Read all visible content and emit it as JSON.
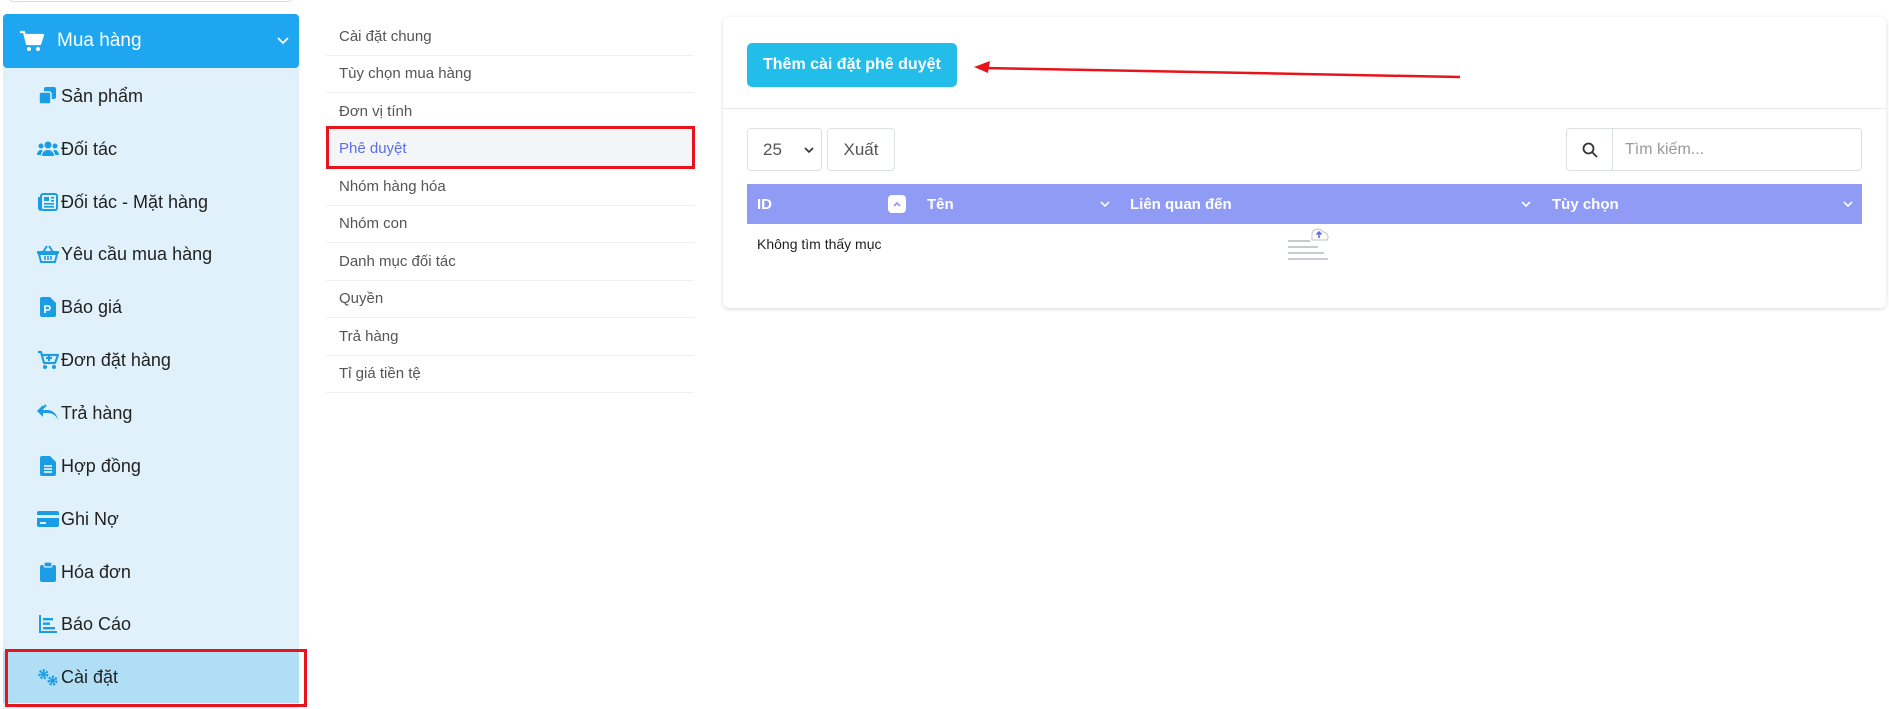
{
  "sidebar": {
    "header": {
      "label": "Mua hàng",
      "icon": "cart-icon"
    },
    "items": [
      {
        "label": "Sản phẩm",
        "icon": "products-icon"
      },
      {
        "label": "Đối tác",
        "icon": "users-icon"
      },
      {
        "label": "Đối tác - Mặt hàng",
        "icon": "newspaper-icon"
      },
      {
        "label": "Yêu cầu mua hàng",
        "icon": "basket-icon"
      },
      {
        "label": "Báo giá",
        "icon": "quote-file-icon"
      },
      {
        "label": "Đơn đặt hàng",
        "icon": "cart-plus-icon"
      },
      {
        "label": "Trả hàng",
        "icon": "reply-all-icon"
      },
      {
        "label": "Hợp đồng",
        "icon": "file-text-icon"
      },
      {
        "label": "Ghi Nợ",
        "icon": "credit-card-icon"
      },
      {
        "label": "Hóa đơn",
        "icon": "clipboard-icon"
      },
      {
        "label": "Báo Cáo",
        "icon": "bar-chart-icon"
      },
      {
        "label": "Cài đặt",
        "icon": "gears-icon",
        "active": true
      }
    ]
  },
  "settings_nav": [
    {
      "label": "Cài đặt chung"
    },
    {
      "label": "Tùy chọn mua hàng"
    },
    {
      "label": "Đơn vị tính"
    },
    {
      "label": "Phê duyệt",
      "active": true
    },
    {
      "label": "Nhóm hàng hóa"
    },
    {
      "label": "Nhóm con"
    },
    {
      "label": "Danh mục đối tác"
    },
    {
      "label": "Quyền"
    },
    {
      "label": "Trả hàng"
    },
    {
      "label": "Tỉ giá tiền tệ"
    }
  ],
  "panel": {
    "add_button": "Thêm cài đặt phê duyệt",
    "page_length": "25",
    "export_button": "Xuất",
    "search_placeholder": "Tìm kiếm...",
    "columns": [
      "ID",
      "Tên",
      "Liên quan đến",
      "Tùy chọn"
    ],
    "empty_text": "Không tìm thấy mục"
  },
  "colors": {
    "sidebar_header": "#1ea7f0",
    "sidebar_bg": "#e1f1fb",
    "sidebar_active": "#b0dff5",
    "accent_icon": "#1b9de5",
    "table_header": "#8f9bf5",
    "add_button": "#23bde9",
    "annotation_red": "#e8141b"
  }
}
